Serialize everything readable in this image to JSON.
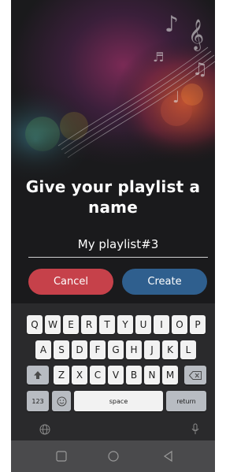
{
  "dialog": {
    "title_line1": "Give your playlist a",
    "title_line2": "name",
    "input_value": "My playlist#3",
    "cancel_label": "Cancel",
    "create_label": "Create"
  },
  "keyboard": {
    "row1": [
      "Q",
      "W",
      "E",
      "R",
      "T",
      "Y",
      "U",
      "I",
      "O",
      "P"
    ],
    "row2": [
      "A",
      "S",
      "D",
      "F",
      "G",
      "H",
      "J",
      "K",
      "L"
    ],
    "row3": [
      "Z",
      "X",
      "C",
      "V",
      "B",
      "N",
      "M"
    ],
    "numbers_label": "123",
    "space_label": "space",
    "return_label": "return"
  },
  "colors": {
    "cancel": "#c6414a",
    "create": "#2f5f8e",
    "background": "#1a1a1c"
  },
  "icons": [
    "music-notes-icon",
    "shift-icon",
    "backspace-icon",
    "emoji-icon",
    "globe-icon",
    "microphone-icon",
    "nav-square-icon",
    "nav-home-icon",
    "nav-back-icon"
  ]
}
